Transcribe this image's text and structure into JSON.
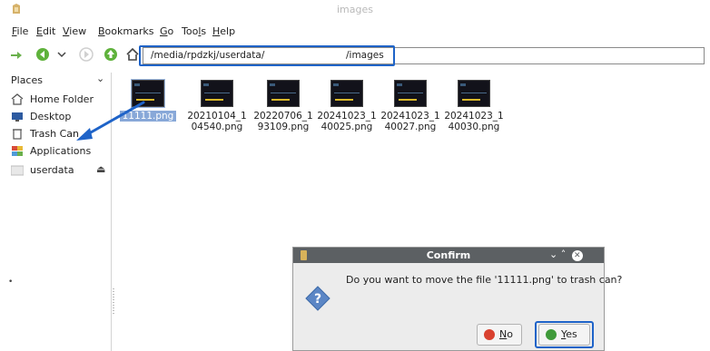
{
  "window": {
    "title": "images"
  },
  "menu": {
    "items": [
      {
        "label": "File",
        "key": "F",
        "rest": "ile"
      },
      {
        "label": "Edit",
        "key": "E",
        "rest": "dit"
      },
      {
        "label": "View",
        "key": "V",
        "rest": "iew"
      },
      {
        "label": "Bookmarks",
        "key": "B",
        "rest": "ookmarks"
      },
      {
        "label": "Go",
        "key": "G",
        "rest": "o"
      },
      {
        "label": "Tools",
        "pre": "Too",
        "key": "l",
        "rest": "s"
      },
      {
        "label": "Help",
        "key": "H",
        "rest": "elp"
      }
    ]
  },
  "toolbar": {
    "path_part1": "/media/rpdzkj/userdata/",
    "path_part2": "/images"
  },
  "sidebar": {
    "header": "Places",
    "items": [
      {
        "label": "Home Folder",
        "icon": "home-icon"
      },
      {
        "label": "Desktop",
        "icon": "desktop-icon"
      },
      {
        "label": "Trash Can",
        "icon": "trash-icon"
      },
      {
        "label": "Applications",
        "icon": "applications-icon"
      },
      {
        "label": "userdata",
        "icon": "drive-icon"
      }
    ]
  },
  "files": [
    {
      "line1": "11111.png",
      "line2": "",
      "selected": true
    },
    {
      "line1": "20210104_1",
      "line2": "04540.png",
      "selected": false
    },
    {
      "line1": "20220706_1",
      "line2": "93109.png",
      "selected": false
    },
    {
      "line1": "20241023_1",
      "line2": "40025.png",
      "selected": false
    },
    {
      "line1": "20241023_1",
      "line2": "40027.png",
      "selected": false
    },
    {
      "line1": "20241023_1",
      "line2": "40030.png",
      "selected": false
    }
  ],
  "dialog": {
    "title": "Confirm",
    "message": "Do you want to move the file '11111.png' to trash can?",
    "no": {
      "key": "N",
      "rest": "o"
    },
    "yes": {
      "key": "Y",
      "rest": "es"
    }
  },
  "colors": {
    "annotation_blue": "#1e63c8",
    "selection": "#88a8d8",
    "dialog_titlebar": "#5c6063"
  }
}
